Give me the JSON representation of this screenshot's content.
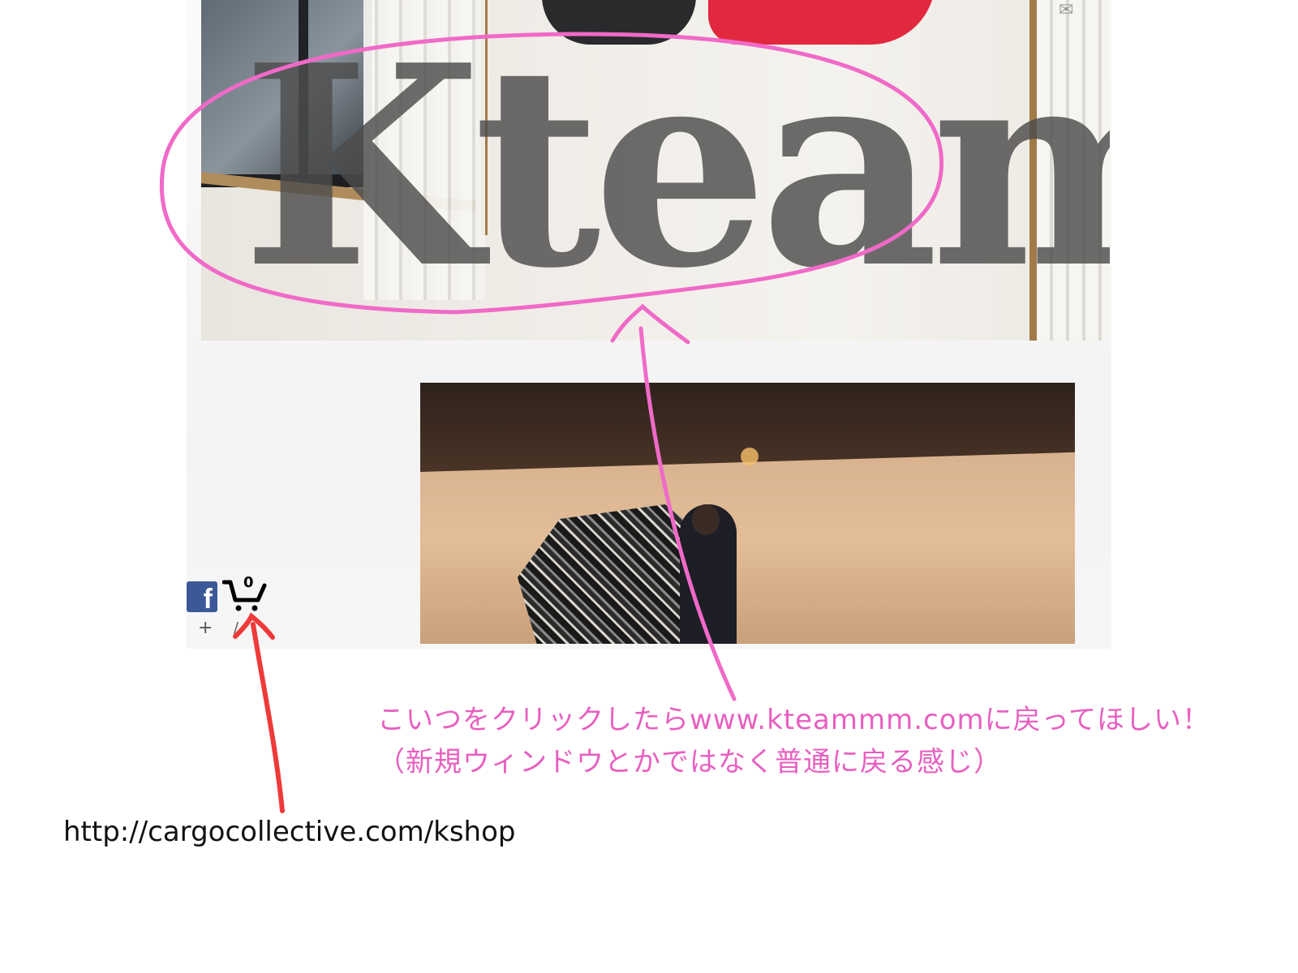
{
  "site": {
    "logo_text": "Kteam",
    "cart_count": "0",
    "facebook_glyph": "f",
    "plus_glyph": "+",
    "share_glyph": "✉"
  },
  "annotation": {
    "line1": "こいつをクリックしたらwww.kteammm.comに戻ってほしい！",
    "line2": "（新規ウィンドウとかではなく普通に戻る感じ）",
    "url": "http://cargocollective.com/kshop"
  },
  "colors": {
    "annotation_pink": "#e85fc0",
    "arrow_red": "#ef3a3a",
    "facebook_blue": "#3b5998"
  },
  "icons": [
    "facebook-icon",
    "cart-icon",
    "mail-icon",
    "plus-icon"
  ]
}
